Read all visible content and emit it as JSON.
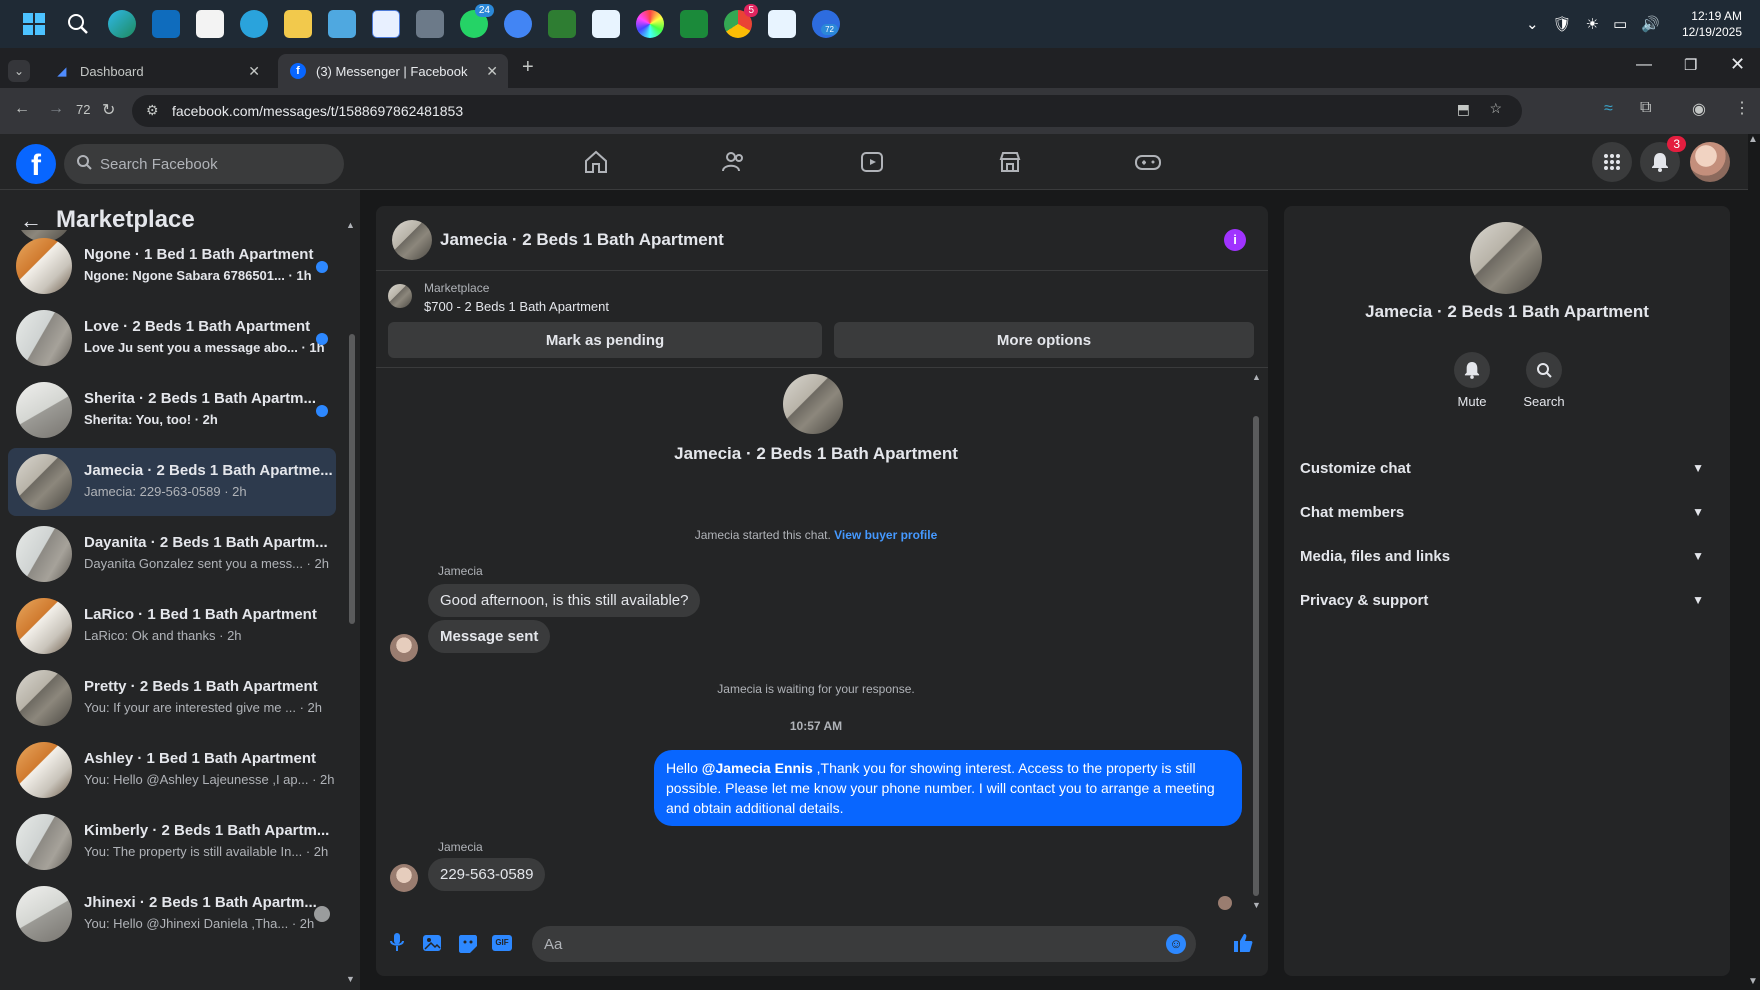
{
  "taskbar": {
    "clock_time": "12:19 AM",
    "clock_date": "12/19/2025",
    "whatsapp_badge": "24",
    "chrome_badge": "5",
    "active_app_badge": "72"
  },
  "browser": {
    "tabs": [
      {
        "title": "Dashboard"
      },
      {
        "title": "(3) Messenger | Facebook"
      }
    ],
    "url": "facebook.com/messages/t/1588697862481853",
    "page_counter": "72"
  },
  "facebook": {
    "search_placeholder": "Search Facebook",
    "notifications_badge": "3"
  },
  "sidebar": {
    "title": "Marketplace",
    "chats": [
      {
        "title": "Ngone · 1 Bed 1 Bath Apartment",
        "subtitle": "Ngone: Ngone Sabara 6786501... · 1h",
        "unread": true,
        "photo": "apt-photo4"
      },
      {
        "title": "Love · 2 Beds 1 Bath Apartment",
        "subtitle": "Love Ju sent you a message abo... · 1h",
        "unread": true,
        "photo": "apt-photo2"
      },
      {
        "title": "Sherita · 2 Beds 1 Bath Apartm...",
        "subtitle": "Sherita: You, too! · 2h",
        "unread": true,
        "photo": "apt-photo3"
      },
      {
        "title": "Jamecia · 2 Beds 1 Bath Apartme...",
        "subtitle": "Jamecia: 229-563-0589 · 2h",
        "unread": false,
        "photo": "apt-photo",
        "selected": true
      },
      {
        "title": "Dayanita · 2 Beds 1 Bath Apartm...",
        "subtitle": "Dayanita Gonzalez sent you a mess... · 2h",
        "unread": false,
        "photo": "apt-photo2"
      },
      {
        "title": "LaRico · 1 Bed 1 Bath Apartment",
        "subtitle": "LaRico: Ok and thanks · 2h",
        "unread": false,
        "photo": "apt-photo4"
      },
      {
        "title": "Pretty · 2 Beds 1 Bath Apartment",
        "subtitle": "You: If your are interested give me ... · 2h",
        "unread": false,
        "photo": "apt-photo"
      },
      {
        "title": "Ashley · 1 Bed 1 Bath Apartment",
        "subtitle": "You: Hello @Ashley Lajeunesse ,I ap... · 2h",
        "unread": false,
        "photo": "apt-photo4"
      },
      {
        "title": "Kimberly · 2 Beds 1 Bath Apartm...",
        "subtitle": "You: The property is still available In... · 2h",
        "unread": false,
        "photo": "apt-photo2"
      },
      {
        "title": "Jhinexi · 2 Beds 1 Bath Apartm...",
        "subtitle": "You: Hello @Jhinexi Daniela ,Tha... · 2h",
        "unread": false,
        "photo": "apt-photo3"
      }
    ]
  },
  "chat": {
    "header_title": "Jamecia · 2 Beds 1 Bath Apartment",
    "listing_source": "Marketplace",
    "listing_detail": "$700 - 2 Beds 1 Bath Apartment",
    "mark_pending_label": "Mark as pending",
    "more_options_label": "More options",
    "intro_name": "Jamecia · 2 Beds 1 Bath Apartment",
    "started_text": "Jamecia started this chat.",
    "view_buyer_label": "View buyer profile",
    "sender_name": "Jamecia",
    "msg1": "Good afternoon, is this still available?",
    "msg2": "Message sent",
    "waiting_text": "Jamecia is waiting for your response.",
    "timestamp": "10:57 AM",
    "out_msg_prefix": "Hello ",
    "out_msg_mention": "@Jamecia Ennis",
    "out_msg_body": " ,Thank you for showing interest. Access to the property is still possible. Please let me know your phone number. I will contact you to arrange a meeting and obtain additional details.",
    "sender_name2": "Jamecia",
    "msg3": "229-563-0589",
    "composer_placeholder": "Aa"
  },
  "details": {
    "name": "Jamecia · 2 Beds 1 Bath Apartment",
    "mute_label": "Mute",
    "search_label": "Search",
    "sections": [
      "Customize chat",
      "Chat members",
      "Media, files and links",
      "Privacy & support"
    ]
  }
}
